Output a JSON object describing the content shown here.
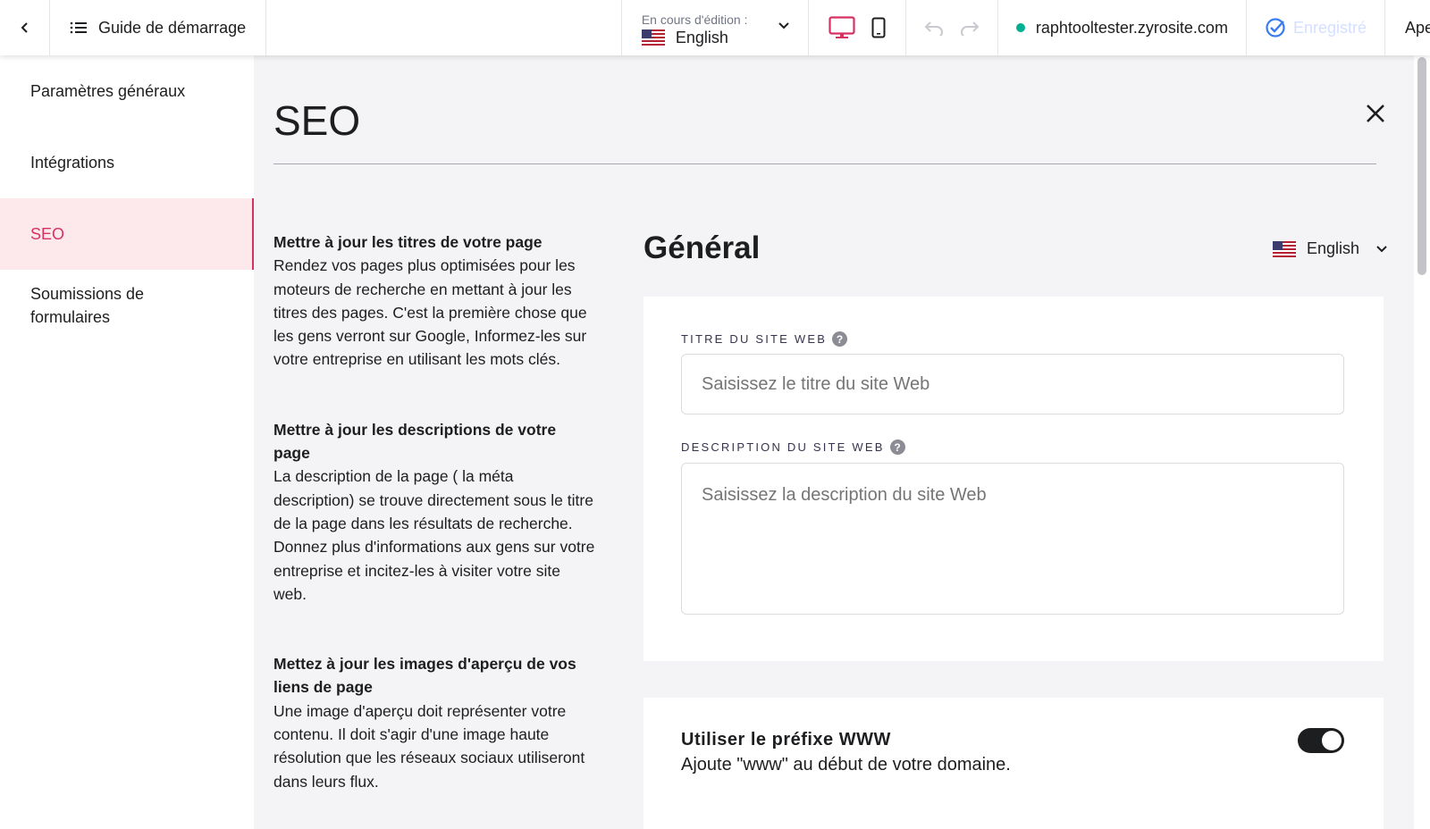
{
  "topbar": {
    "guide_label": "Guide de démarrage",
    "editing_label": "En cours d'édition :",
    "editing_language": "English",
    "domain": "raphtooltester.zyrosite.com",
    "saved_label": "Enregistré",
    "truncated_action": "Ape"
  },
  "sidebar": {
    "items": [
      {
        "label": "Paramètres généraux"
      },
      {
        "label": "Intégrations"
      },
      {
        "label": "SEO"
      },
      {
        "label": "Soumissions de formulaires"
      }
    ]
  },
  "main": {
    "page_title": "SEO",
    "help": [
      {
        "title": "Mettre à jour les titres de votre page",
        "text": "Rendez vos pages plus optimisées pour les moteurs de recherche en mettant à jour les titres des pages. C'est la première chose que les gens verront sur Google, Informez-les sur votre entreprise en utilisant les mots clés."
      },
      {
        "title": "Mettre à jour les descriptions de votre page",
        "text": "La description de la page ( la méta description) se trouve directement sous le titre de la page dans les résultats de recherche. Donnez plus d'informations aux gens sur votre entreprise et incitez-les à visiter votre site web."
      },
      {
        "title": "Mettez à jour les images d'aperçu de vos liens de page",
        "text": "Une image d'aperçu doit représenter votre contenu. Il doit s'agir d'une image haute résolution que les réseaux sociaux utiliseront dans leurs flux."
      }
    ],
    "general_title": "Général",
    "language": "English",
    "site_title_label": "TITRE DU SITE WEB",
    "site_title_placeholder": "Saisissez le titre du site Web",
    "site_description_label": "DESCRIPTION DU SITE WEB",
    "site_description_placeholder": "Saisissez la description du site Web",
    "www_title": "Utiliser le préfixe WWW",
    "www_description": "Ajoute \"www\" au début de votre domaine.",
    "www_enabled": true
  },
  "colors": {
    "accent": "#d63163",
    "active_bg": "#fde9ec",
    "online": "#00b090",
    "saved": "#d5dfff"
  }
}
